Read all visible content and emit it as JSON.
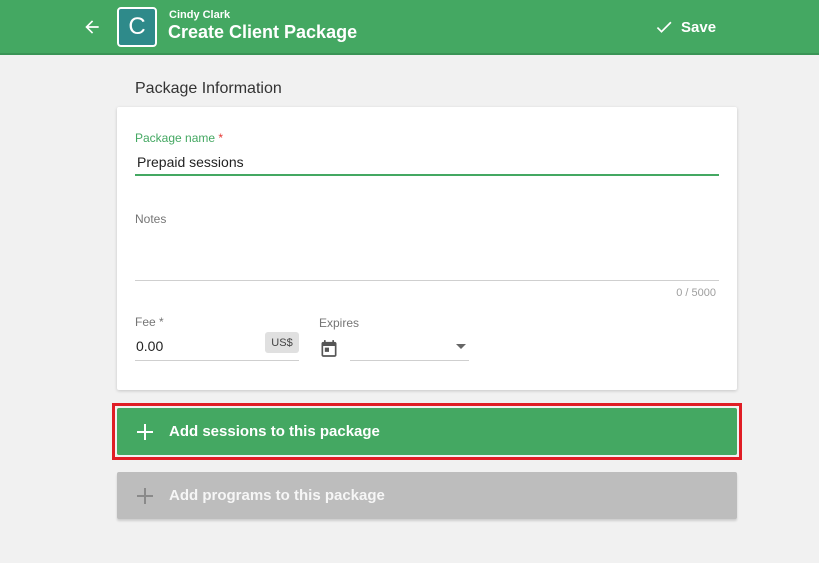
{
  "header": {
    "user_name": "Cindy Clark",
    "title": "Create Client Package",
    "avatar_letter": "C",
    "save_label": "Save",
    "back_icon": "arrow-left-icon",
    "save_icon": "check-icon",
    "color": "#44a862"
  },
  "package_info": {
    "section_title": "Package Information",
    "name": {
      "label": "Package name",
      "required_mark": "*",
      "value": "Prepaid sessions"
    },
    "notes": {
      "label": "Notes",
      "value": "",
      "counter": "0 / 5000"
    },
    "fee": {
      "label": "Fee *",
      "value": "0.00",
      "currency": "US$"
    },
    "expires": {
      "label": "Expires",
      "value": "",
      "icon": "calendar-icon"
    }
  },
  "actions": {
    "add_sessions_label": "Add sessions to this package",
    "add_programs_label": "Add programs to this package",
    "highlight_color": "#e01d25",
    "disabled_color": "#bdbdbd"
  }
}
